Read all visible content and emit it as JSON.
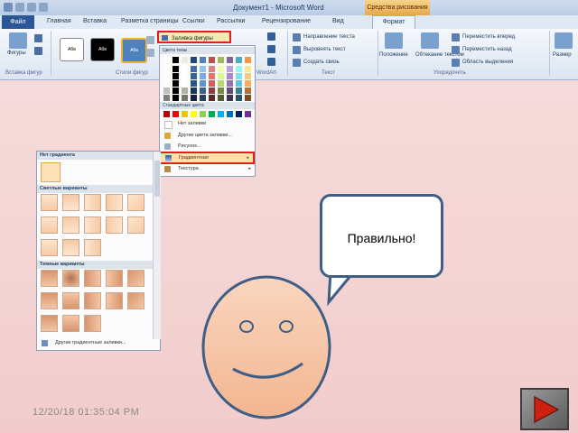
{
  "app": {
    "title": "Документ1 - Microsoft Word",
    "context_tab": "Средства рисования"
  },
  "ribbon": {
    "tabs": [
      "Файл",
      "Главная",
      "Вставка",
      "Разметка страницы",
      "Ссылки",
      "Рассылки",
      "Рецензирование",
      "Вид",
      "Формат"
    ],
    "fill_button_label": "Заливка фигуры",
    "style_boxes": [
      "Абв",
      "Абв",
      "Абв"
    ],
    "group_labels": {
      "insert_shapes": "Вставка фигур",
      "shape_styles": "Стили фигур",
      "text": "Текст",
      "arrange": "Упорядочить",
      "wordart": "WordArt"
    },
    "left_labels": {
      "shapes": "Фигуры"
    },
    "text_group": [
      "Направление текста",
      "Выровнять текст",
      "Создать связь"
    ],
    "arrange_buttons": [
      "Положение",
      "Обтекание текстом"
    ],
    "arrange_items": [
      "Переместить вперед",
      "Переместить назад",
      "Область выделения"
    ],
    "size_label": "Размер"
  },
  "color_menu": {
    "theme_header": "Цвета темы",
    "standard_header": "Стандартные цвета",
    "items": [
      "Нет заливки",
      "Другие цвета заливки...",
      "Рисунок...",
      "Градиентная",
      "Текстура"
    ],
    "theme_colors": [
      "#ffffff",
      "#000000",
      "#eeece1",
      "#1f497d",
      "#4f81bd",
      "#c0504d",
      "#9bbb59",
      "#8064a2",
      "#4bacc6",
      "#f79646"
    ],
    "standard_colors": [
      "#c00000",
      "#ff0000",
      "#ffc000",
      "#ffff00",
      "#92d050",
      "#00b050",
      "#00b0f0",
      "#0070c0",
      "#002060",
      "#7030a0"
    ]
  },
  "gallery": {
    "no_gradient_header": "Нет градиента",
    "light_header": "Светлые варианты",
    "dark_header": "Темные варианты",
    "more_link": "Другие градиентные заливки...",
    "light_count": 13,
    "dark_count": 13
  },
  "bubble": {
    "text": "Правильно!"
  },
  "footer": {
    "date": "12/20/18 01:35:04 PM"
  }
}
